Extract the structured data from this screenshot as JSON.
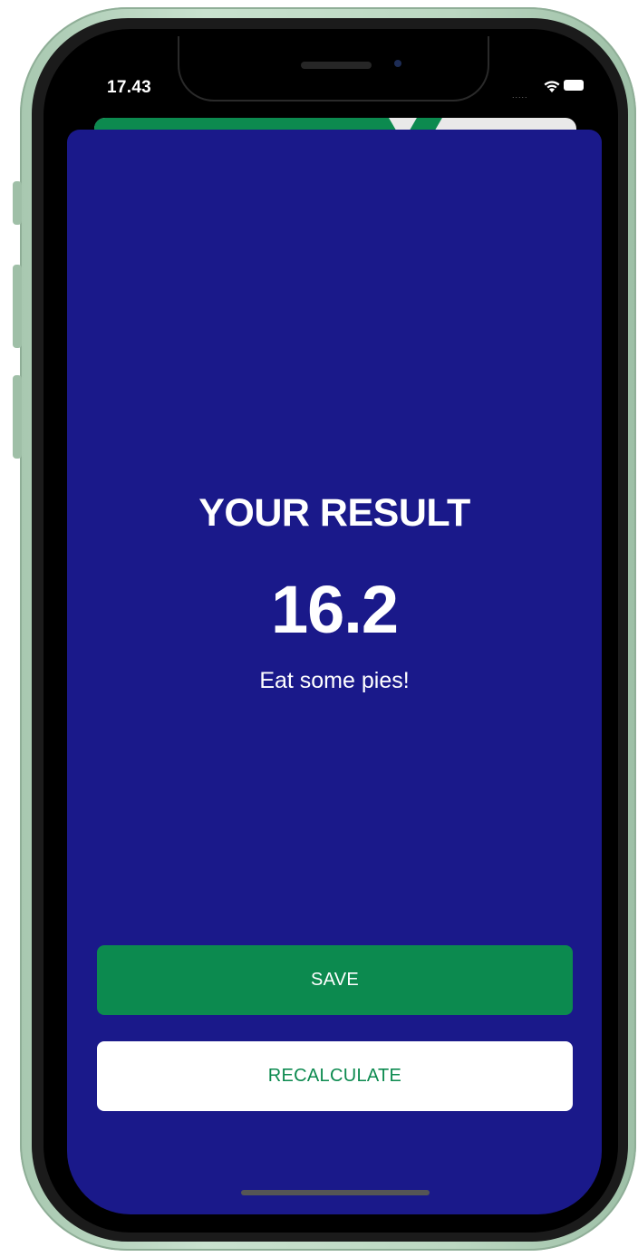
{
  "status_bar": {
    "time": "17.43",
    "signal": "....."
  },
  "icons": {
    "wifi": "wifi-icon",
    "battery": "battery-icon"
  },
  "colors": {
    "card_background": "#1a198a",
    "accent_green": "#0c8a4f",
    "text": "#ffffff"
  },
  "result": {
    "title": "YOUR RESULT",
    "value": "16.2",
    "advice": "Eat some pies!"
  },
  "actions": {
    "save_label": "SAVE",
    "recalculate_label": "RECALCULATE"
  }
}
